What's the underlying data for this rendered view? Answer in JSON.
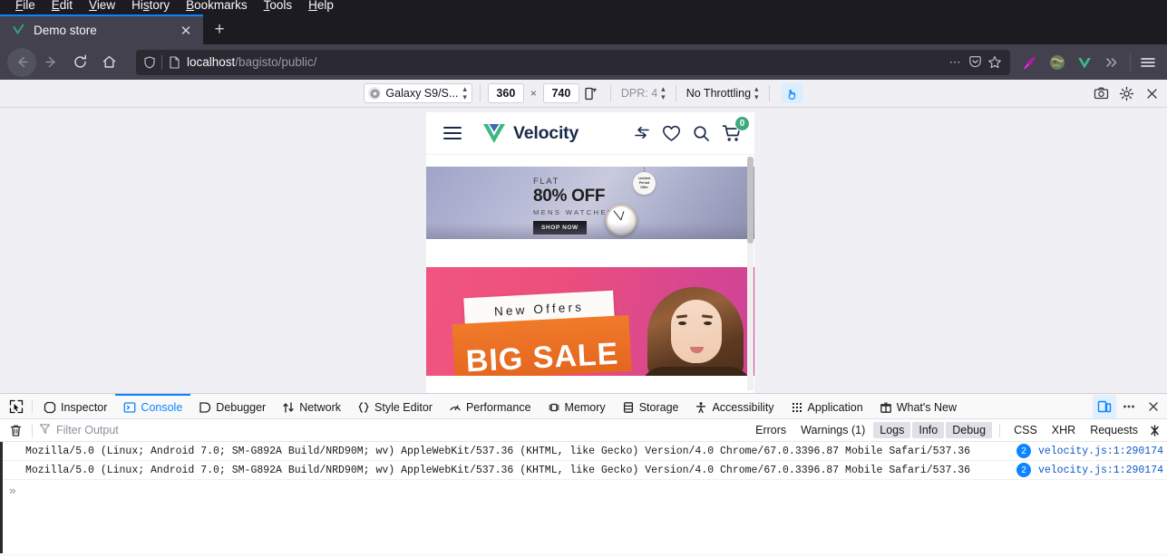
{
  "browser": {
    "menubar": [
      {
        "label": "File",
        "accel": "F"
      },
      {
        "label": "Edit",
        "accel": "E"
      },
      {
        "label": "View",
        "accel": "V"
      },
      {
        "label": "History",
        "accel": "s"
      },
      {
        "label": "Bookmarks",
        "accel": "B"
      },
      {
        "label": "Tools",
        "accel": "T"
      },
      {
        "label": "Help",
        "accel": "H"
      }
    ],
    "tab": {
      "title": "Demo store",
      "favicon": "velocity-check-icon",
      "close_label": "✕"
    },
    "new_tab_label": "+",
    "url": {
      "host": "localhost",
      "path": "/bagisto/public/",
      "full": "localhost/bagisto/public/"
    },
    "urlbar_icons": [
      "shield-icon",
      "page-icon",
      "more-options-icon",
      "save-to-pocket-icon",
      "bookmark-star-icon"
    ],
    "nav_icons": [
      "back-arrow-icon",
      "forward-arrow-icon",
      "reload-icon",
      "home-icon"
    ],
    "extension_icons": [
      "feather-pen-extension-icon",
      "globe-extension-icon",
      "vue-devtools-icon",
      "overflow-chevrons-icon"
    ],
    "menu_icon": "hamburger-menu-icon"
  },
  "rdm": {
    "device": "Galaxy S9/S...",
    "width": "360",
    "height": "740",
    "separator": "×",
    "rotate_icon": "rotate-viewport-icon",
    "dpr_label": "DPR: 4",
    "throttling": "No Throttling",
    "touch_icon": "touch-simulation-icon",
    "right_buttons": [
      "camera-screenshot-icon",
      "rdm-settings-gear-icon",
      "close-rdm-icon"
    ]
  },
  "site": {
    "brand": "Velocity",
    "header_icons": [
      "compare-icon",
      "wishlist-heart-icon",
      "search-icon",
      "cart-icon"
    ],
    "cart_count": "0",
    "menu_icon": "hamburger-menu-icon",
    "banner1": {
      "kicker": "FLAT",
      "headline": "80% OFF",
      "subhead": "MENS WATCHES",
      "cta": "SHOP NOW",
      "tag_line1": "Limited",
      "tag_line2": "Period",
      "tag_line3": "Offer"
    },
    "banner2": {
      "kicker": "New Offers",
      "headline": "BIG SALE"
    }
  },
  "devtools": {
    "picker_icon": "element-picker-icon",
    "tabs": [
      {
        "label": "Inspector",
        "icon": "inspector-icon",
        "active": false
      },
      {
        "label": "Console",
        "icon": "console-icon",
        "active": true
      },
      {
        "label": "Debugger",
        "icon": "debugger-icon",
        "active": false
      },
      {
        "label": "Network",
        "icon": "network-icon",
        "active": false
      },
      {
        "label": "Style Editor",
        "icon": "style-editor-icon",
        "active": false
      },
      {
        "label": "Performance",
        "icon": "performance-icon",
        "active": false
      },
      {
        "label": "Memory",
        "icon": "memory-icon",
        "active": false
      },
      {
        "label": "Storage",
        "icon": "storage-icon",
        "active": false
      },
      {
        "label": "Accessibility",
        "icon": "accessibility-icon",
        "active": false
      },
      {
        "label": "Application",
        "icon": "application-icon",
        "active": false
      },
      {
        "label": "What's New",
        "icon": "whats-new-icon",
        "active": false
      }
    ],
    "right_buttons": [
      "responsive-design-mode-icon",
      "devtools-meatball-menu-icon",
      "close-devtools-icon"
    ],
    "filterbar": {
      "trash_icon": "clear-console-trash-icon",
      "filter_icon": "filter-funnel-icon",
      "filter_placeholder": "Filter Output",
      "pills": [
        {
          "label": "Errors",
          "on": false
        },
        {
          "label": "Warnings (1)",
          "on": false
        },
        {
          "label": "Logs",
          "on": true
        },
        {
          "label": "Info",
          "on": true
        },
        {
          "label": "Debug",
          "on": true
        },
        {
          "label": "CSS",
          "on": false
        },
        {
          "label": "XHR",
          "on": false
        },
        {
          "label": "Requests",
          "on": false
        }
      ],
      "end_icon": "console-settings-icon"
    },
    "console_rows": [
      {
        "message": "Mozilla/5.0 (Linux; Android 7.0; SM-G892A Build/NRD90M; wv) AppleWebKit/537.36 (KHTML, like Gecko) Version/4.0 Chrome/67.0.3396.87 Mobile Safari/537.36",
        "count": "2",
        "source": "velocity.js:1:290174"
      },
      {
        "message": "Mozilla/5.0 (Linux; Android 7.0; SM-G892A Build/NRD90M; wv) AppleWebKit/537.36 (KHTML, like Gecko) Version/4.0 Chrome/67.0.3396.87 Mobile Safari/537.36",
        "count": "2",
        "source": "velocity.js:1:290174"
      }
    ],
    "prompt": "»"
  },
  "colors": {
    "accent_blue": "#0a84ff",
    "brand_navy": "#1a2b4a",
    "brand_green": "#3caa7d",
    "chrome_dark": "#1c1b22",
    "chrome_nav": "#42414d"
  }
}
